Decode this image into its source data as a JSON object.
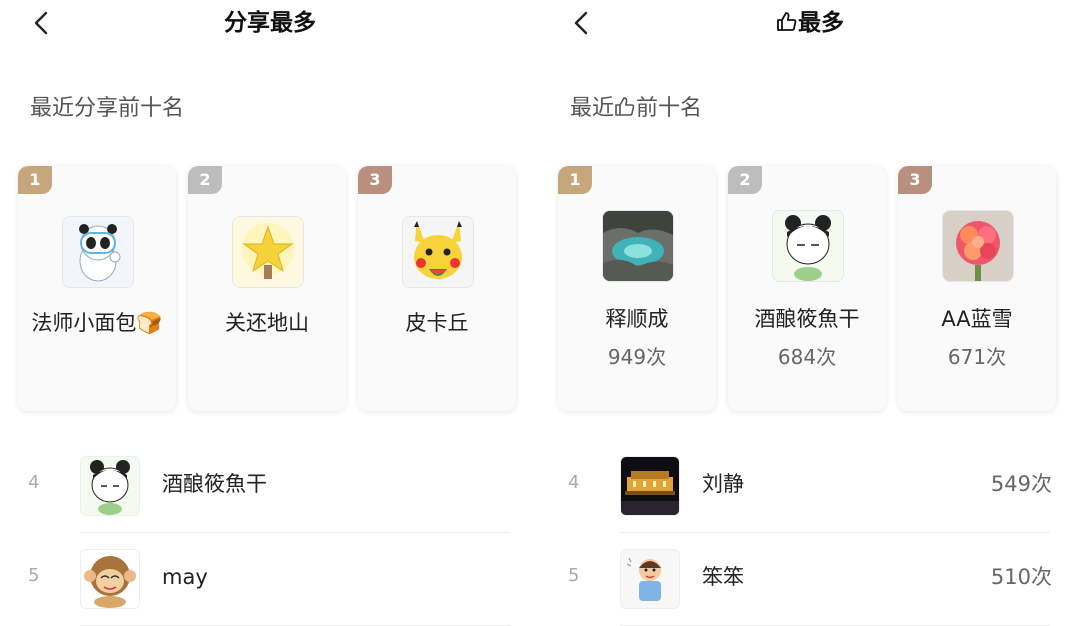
{
  "share_panel": {
    "title": "分享最多",
    "section_title": "最近分享前十名",
    "top3": [
      {
        "rank": "1",
        "name": "法师小面包🍞",
        "count": ""
      },
      {
        "rank": "2",
        "name": "关还地山",
        "count": ""
      },
      {
        "rank": "3",
        "name": "皮卡丘",
        "count": ""
      }
    ],
    "list": [
      {
        "rank": "4",
        "name": "酒酿筱魚干",
        "count": ""
      },
      {
        "rank": "5",
        "name": "may",
        "count": ""
      }
    ]
  },
  "like_panel": {
    "title": "最多",
    "section_title_prefix": "最近",
    "section_title_suffix": "前十名",
    "top3": [
      {
        "rank": "1",
        "name": "释顺成",
        "count": "949次"
      },
      {
        "rank": "2",
        "name": "酒酿筱魚干",
        "count": "684次"
      },
      {
        "rank": "3",
        "name": "AA蓝雪",
        "count": "671次"
      }
    ],
    "list": [
      {
        "rank": "4",
        "name": "刘静",
        "count": "549次"
      },
      {
        "rank": "5",
        "name": "笨笨",
        "count": "510次"
      }
    ]
  },
  "icons": {
    "back": "chevron-left-icon",
    "thumbs_up": "thumbs-up-icon"
  },
  "colors": {
    "rank1": "#c6a77b",
    "rank2": "#bdbdbd",
    "rank3": "#b98f80"
  }
}
